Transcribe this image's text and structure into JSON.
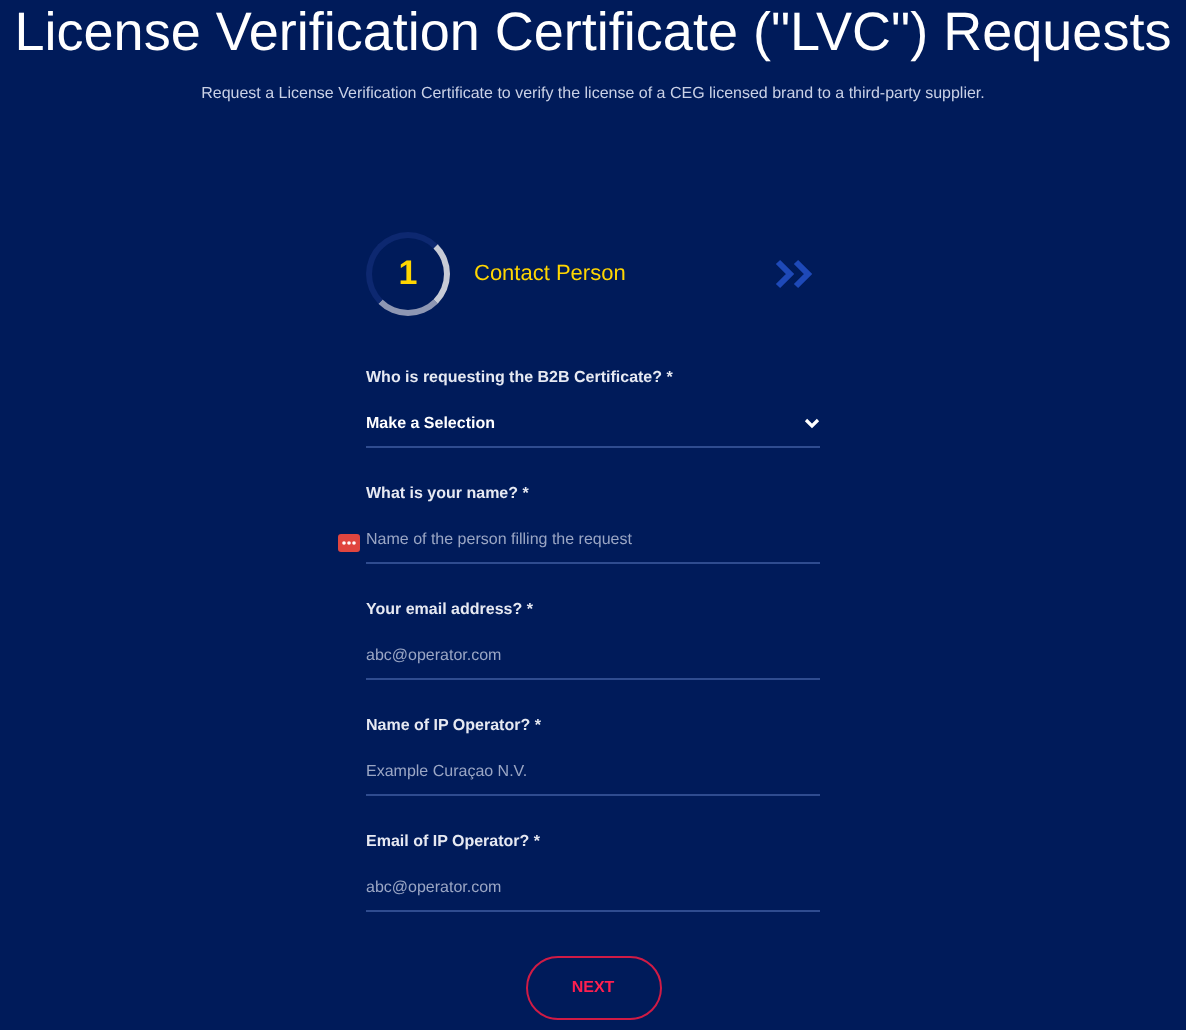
{
  "title": "License Verification Certificate (\"LVC\") Requests",
  "subtitle": "Request a License Verification Certificate to verify the license of a CEG licensed brand to a third-party supplier.",
  "step": {
    "number": "1",
    "label": "Contact Person"
  },
  "fields": [
    {
      "kind": "select",
      "label": "Who is requesting the B2B Certificate? *",
      "value": "Make a Selection"
    },
    {
      "kind": "text",
      "label": "What is your name? *",
      "placeholder": "Name of the person filling the request",
      "autofill_icon": true
    },
    {
      "kind": "text",
      "label": "Your email address? *",
      "placeholder": "abc@operator.com"
    },
    {
      "kind": "text",
      "label": "Name of IP Operator? *",
      "placeholder": "Example Curaçao N.V."
    },
    {
      "kind": "text",
      "label": "Email of IP Operator? *",
      "placeholder": "abc@operator.com"
    }
  ],
  "next_button": "NEXT"
}
